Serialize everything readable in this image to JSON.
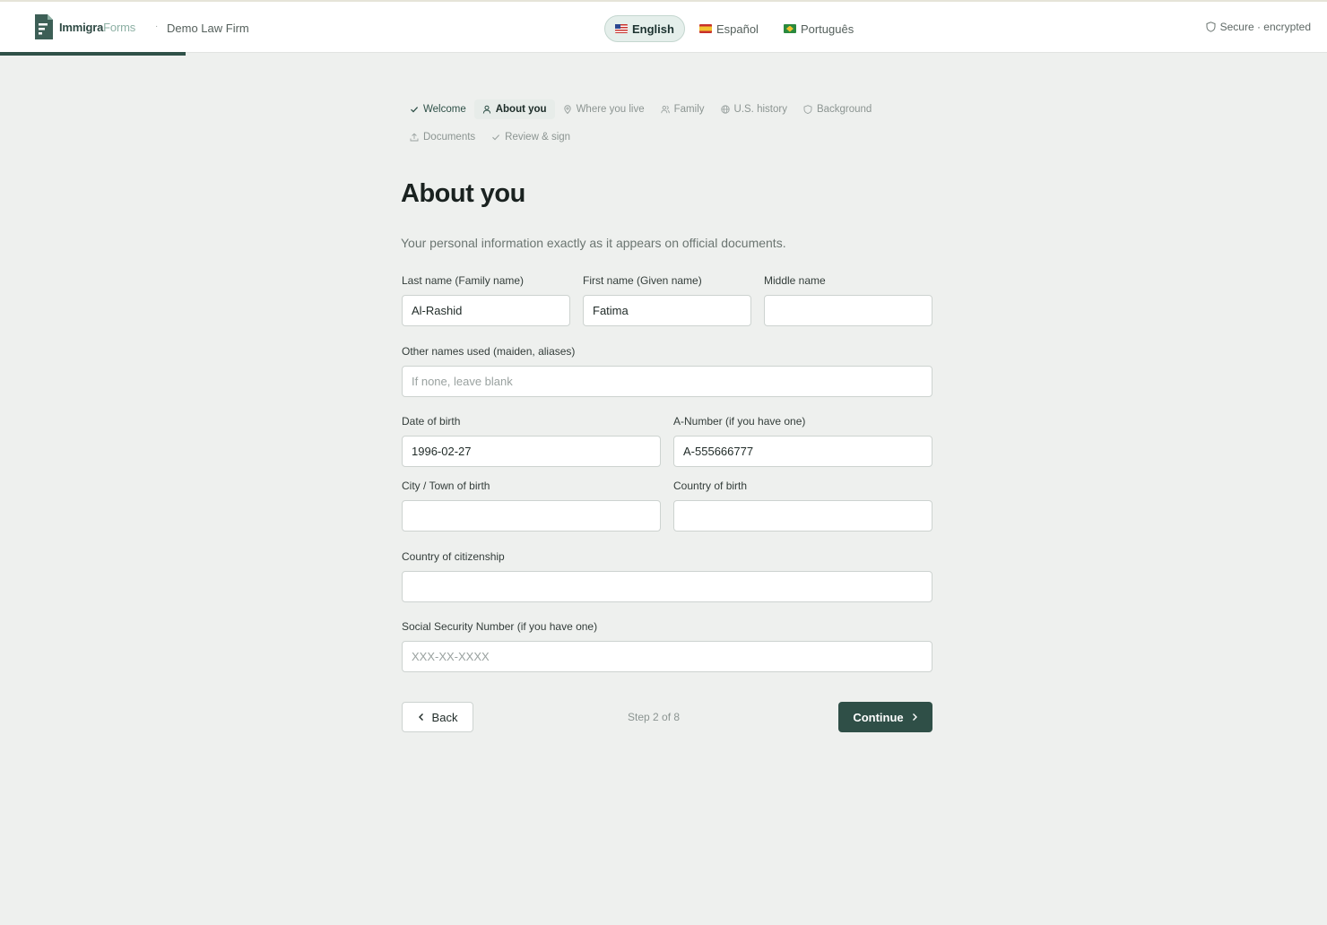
{
  "brand": {
    "name_part1": "Immigra",
    "name_part2": "Forms",
    "firm": "Demo Law Firm",
    "separator": "·"
  },
  "languages": [
    {
      "label": "English",
      "flag": "us-flag-icon",
      "active": true
    },
    {
      "label": "Español",
      "flag": "es-flag-icon",
      "active": false
    },
    {
      "label": "Português",
      "flag": "br-flag-icon",
      "active": false
    }
  ],
  "secure_label": "Secure · encrypted",
  "steps": [
    {
      "label": "Welcome",
      "icon": "check-icon",
      "state": "done"
    },
    {
      "label": "About you",
      "icon": "person-icon",
      "state": "current"
    },
    {
      "label": "Where you live",
      "icon": "map-pin-icon",
      "state": "upcoming"
    },
    {
      "label": "Family",
      "icon": "people-icon",
      "state": "upcoming"
    },
    {
      "label": "U.S. history",
      "icon": "globe-icon",
      "state": "upcoming"
    },
    {
      "label": "Background",
      "icon": "shield-icon",
      "state": "upcoming"
    },
    {
      "label": "Documents",
      "icon": "upload-icon",
      "state": "upcoming"
    },
    {
      "label": "Review & sign",
      "icon": "check-icon",
      "state": "upcoming"
    }
  ],
  "page": {
    "title": "About you",
    "subtitle": "Your personal information exactly as it appears on official documents."
  },
  "form": {
    "last_name": {
      "label": "Last name (Family name)",
      "value": "Al-Rashid",
      "placeholder": ""
    },
    "first_name": {
      "label": "First name (Given name)",
      "value": "Fatima",
      "placeholder": ""
    },
    "middle_name": {
      "label": "Middle name",
      "value": "",
      "placeholder": ""
    },
    "other_names": {
      "label": "Other names used (maiden, aliases)",
      "value": "",
      "placeholder": "If none, leave blank"
    },
    "dob": {
      "label": "Date of birth",
      "value": "1996-02-27",
      "placeholder": ""
    },
    "a_number": {
      "label": "A-Number (if you have one)",
      "value": "A-555666777",
      "placeholder": ""
    },
    "city_birth": {
      "label": "City / Town of birth",
      "value": "",
      "placeholder": ""
    },
    "country_birth": {
      "label": "Country of birth",
      "value": "",
      "placeholder": ""
    },
    "citizenship": {
      "label": "Country of citizenship",
      "value": "",
      "placeholder": ""
    },
    "ssn": {
      "label": "Social Security Number (if you have one)",
      "value": "",
      "placeholder": "XXX-XX-XXXX"
    }
  },
  "nav": {
    "back_label": "Back",
    "step_text": "Step 2 of 8",
    "continue_label": "Continue"
  },
  "progress_fraction": 0.14,
  "colors": {
    "accent": "#2f4f47",
    "background": "#eef0ee"
  }
}
